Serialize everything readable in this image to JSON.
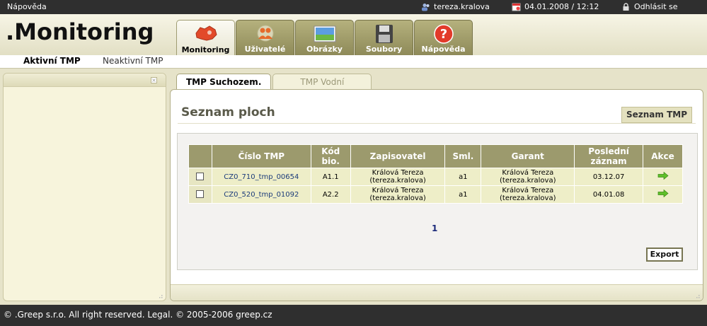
{
  "topbar": {
    "help": "Nápověda",
    "user": "tereza.kralova",
    "datetime": "04.01.2008 / 12:12",
    "logout": "Odhlásit se"
  },
  "header": {
    "logo": ".Monitoring",
    "tabs": [
      {
        "label": "Monitoring",
        "icon": "map-icon"
      },
      {
        "label": "Uživatelé",
        "icon": "users-icon"
      },
      {
        "label": "Obrázky",
        "icon": "image-icon"
      },
      {
        "label": "Soubory",
        "icon": "floppy-icon"
      },
      {
        "label": "Nápověda",
        "icon": "help-icon"
      }
    ]
  },
  "subnav": {
    "active": "Aktivní TMP",
    "inactive": "Neaktivní TMP"
  },
  "main": {
    "subtabs": [
      "TMP Suchozem.",
      "TMP Vodní"
    ],
    "title": "Seznam ploch",
    "right_button": "Seznam TMP",
    "table": {
      "headers": [
        "",
        "Číslo TMP",
        "Kód bio.",
        "Zapisovatel",
        "Sml.",
        "Garant",
        "Poslední záznam",
        "Akce"
      ],
      "rows": [
        {
          "tmp": "CZ0_710_tmp_00654",
          "kod": "A1.1",
          "zapisovatel": "Králová Tereza (tereza.kralova)",
          "sml": "a1",
          "garant": "Králová Tereza (tereza.kralova)",
          "posledni": "03.12.07"
        },
        {
          "tmp": "CZ0_520_tmp_01092",
          "kod": "A2.2",
          "zapisovatel": "Králová Tereza (tereza.kralova)",
          "sml": "a1",
          "garant": "Králová Tereza (tereza.kralova)",
          "posledni": "04.01.08"
        }
      ]
    },
    "page": "1",
    "export": "Export"
  },
  "footer": {
    "text": "© .Greep s.r.o. All right reserved. Legal. © 2005-2006 greep.cz"
  },
  "colors": {
    "accent": "#9c9a6d",
    "topbar": "#2f2f2f",
    "row": "#eeeec8"
  }
}
